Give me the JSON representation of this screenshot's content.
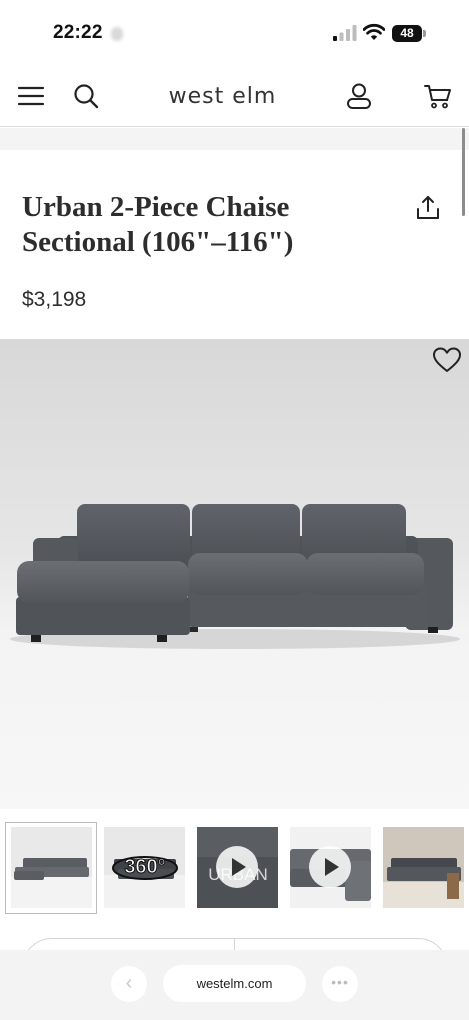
{
  "status_bar": {
    "time": "22:22",
    "battery": "48",
    "icons": [
      "signal-icon",
      "wifi-icon",
      "battery-icon"
    ]
  },
  "header": {
    "logo": "west elm",
    "icons": [
      "menu-icon",
      "search-icon",
      "account-icon",
      "cart-icon"
    ]
  },
  "product": {
    "title": "Urban 2-Piece Chaise Sectional (106\"–116\")",
    "price": "$3,198",
    "icons": [
      "share-icon",
      "heart-icon"
    ]
  },
  "gallery": {
    "thumbnails": [
      {
        "kind": "image",
        "selected": true
      },
      {
        "kind": "360",
        "label": "360°"
      },
      {
        "kind": "video",
        "label": "URBAN"
      },
      {
        "kind": "video"
      },
      {
        "kind": "image"
      }
    ]
  },
  "browser": {
    "url": "westelm.com",
    "back_glyph": "‹",
    "more_glyph": "•••"
  },
  "colors": {
    "sofa_fabric": "#5a5e63",
    "text": "#2d2d2d",
    "divider": "#dcdcdc"
  }
}
